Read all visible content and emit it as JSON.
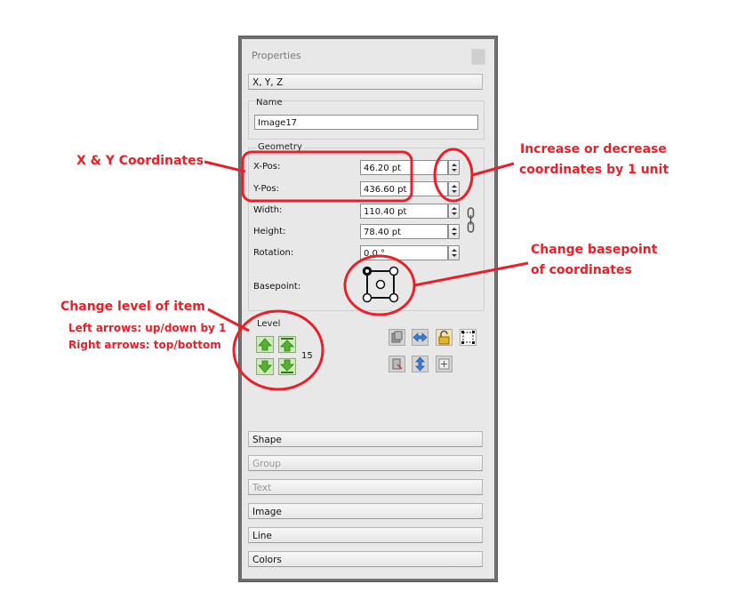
{
  "panel": {
    "title": "Properties",
    "close_label": "×",
    "top_section": "X, Y, Z",
    "name_group": {
      "label": "Name",
      "value": "Image17"
    },
    "geometry": {
      "label": "Geometry",
      "xpos": {
        "label": "X-Pos:",
        "value": "46.20 pt"
      },
      "ypos": {
        "label": "Y-Pos:",
        "value": "436.60 pt"
      },
      "width": {
        "label": "Width:",
        "value": "110.40 pt"
      },
      "height": {
        "label": "Height:",
        "value": "78.40 pt"
      },
      "rotation": {
        "label": "Rotation:",
        "value": "0.0 °"
      },
      "basepoint": {
        "label": "Basepoint:"
      }
    },
    "level": {
      "label": "Level",
      "value": "15"
    },
    "sections": [
      {
        "label": "Shape",
        "enabled": true
      },
      {
        "label": "Group",
        "enabled": false
      },
      {
        "label": "Text",
        "enabled": false
      },
      {
        "label": "Image",
        "enabled": true
      },
      {
        "label": "Line",
        "enabled": true
      },
      {
        "label": "Colors",
        "enabled": true
      }
    ]
  },
  "annotations": {
    "xy": "X & Y Coordinates",
    "increase_line1": "Increase or decrease",
    "increase_line2": "coordinates by 1 unit",
    "basepoint_line1": "Change basepoint",
    "basepoint_line2": "of coordinates",
    "level_title": "Change level of item",
    "level_line1": "Left arrows: up/down by 1",
    "level_line2": "Right arrows: top/bottom"
  },
  "colors": {
    "annotation_red": "#e8202a",
    "arrow_green": "#52b432",
    "panel_bg": "#e8e8e8"
  },
  "icons": [
    "close-icon",
    "spin-up-down-icon",
    "chain-link-icon",
    "basepoint-icon",
    "arrow-up-icon",
    "arrow-top-icon",
    "arrow-down-icon",
    "arrow-bottom-icon",
    "flip-horizontal-icon",
    "flip-vertical-icon",
    "lock-icon",
    "size-lock-icon",
    "print-icon",
    "duplicate-icon"
  ]
}
